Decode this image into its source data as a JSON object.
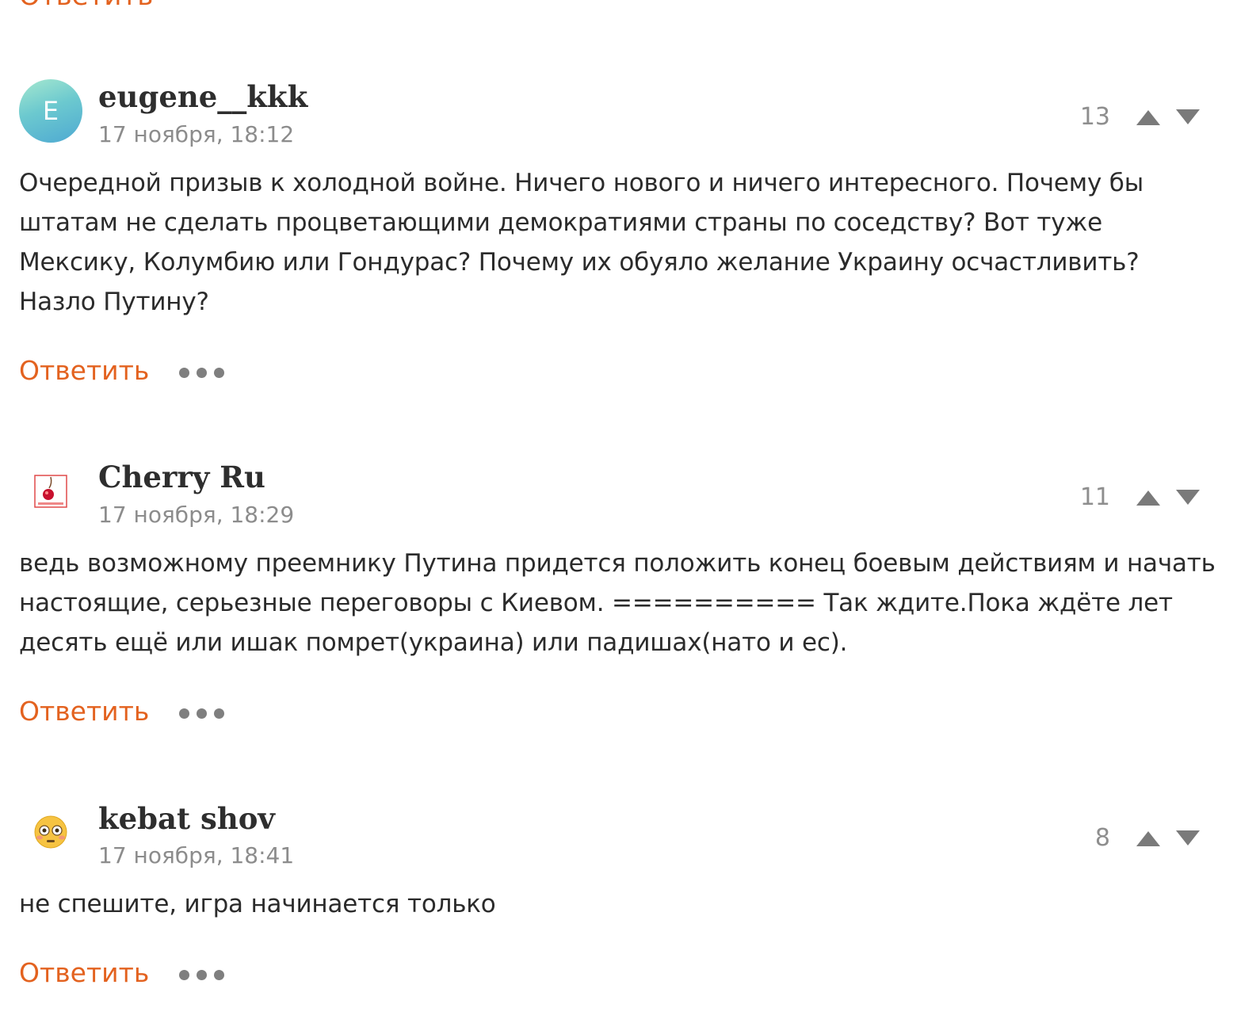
{
  "top_partial": "Ответить",
  "comments": [
    {
      "author": "eugene__kkk",
      "avatar_letter": "E",
      "date": "17 ноября, 18:12",
      "score": "13",
      "text": "Очередной призыв к холодной войне. Ничего нового и ничего интересного. Почему бы штатам не сделать процветающими демократиями страны по соседству? Вот туже Мексику, Колумбию или Гондурас? Почему их обуяло желание Украину осчастливить? Назло Путину?",
      "reply_label": "Ответить"
    },
    {
      "author": "Cherry Ru",
      "avatar_icon": "cherry-avatar-icon",
      "date": "17 ноября, 18:29",
      "score": "11",
      "text": "ведь возможному преемнику Путина придется положить конец боевым действиям и начать настоящие, серьезные переговоры с Киевом. ========== Так ждите.Пока ждёте лет десять ещё или ишак помрет(украина) или падишах(нато и ес).",
      "reply_label": "Ответить"
    },
    {
      "author": "kebat shov",
      "avatar_icon": "flushed-face-emoji-icon",
      "date": "17 ноября, 18:41",
      "score": "8",
      "text": "не спешите, игра начинается только",
      "reply_label": "Ответить"
    }
  ],
  "colors": {
    "accent": "#e3621f",
    "muted": "#8c8c8c",
    "text": "#2b2b2b"
  }
}
